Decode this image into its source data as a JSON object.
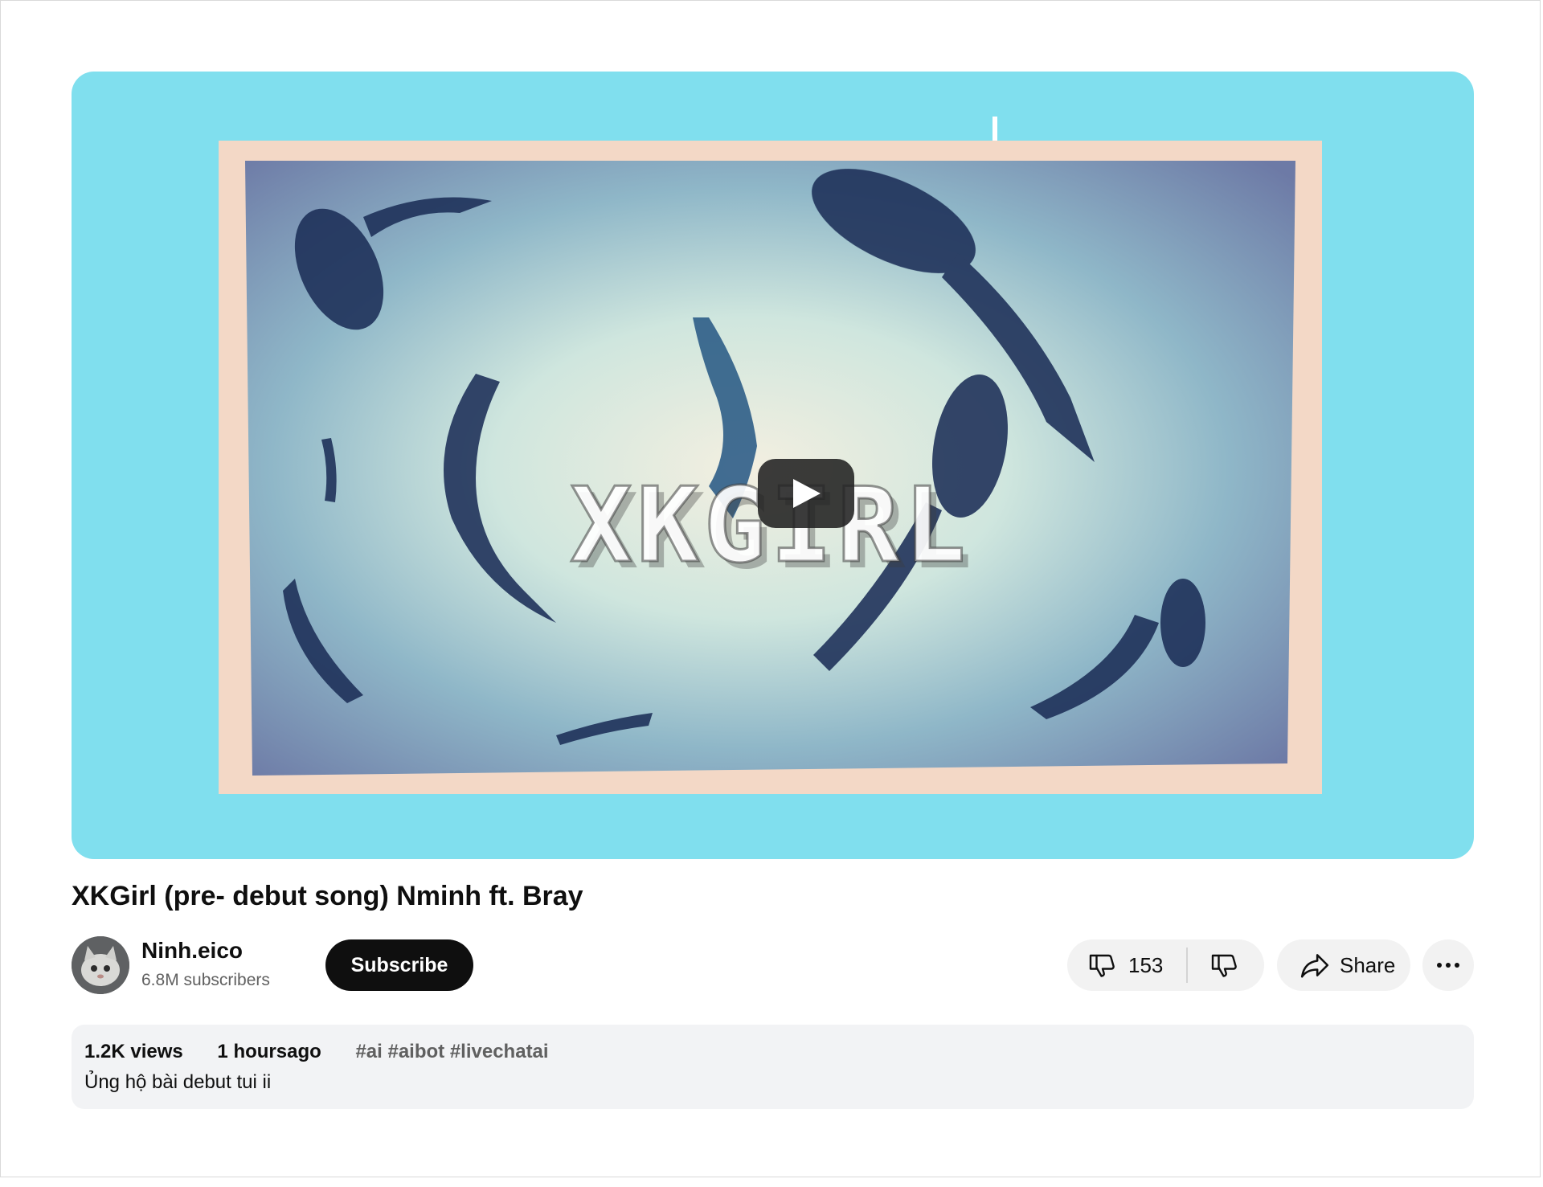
{
  "player": {
    "overlay_text": "XKGIRL",
    "play_icon": "play-icon",
    "colors": {
      "background": "#80dfee",
      "thumbnail_paper": "#f3d8c6"
    }
  },
  "video": {
    "title": "XKGirl (pre- debut song) Nminh ft. Bray"
  },
  "channel": {
    "name": "Ninh.eico",
    "subscribers": "6.8M subscribers",
    "subscribe_label": "Subscribe"
  },
  "actions": {
    "like_count": "153",
    "like_icon": "thumbs-down-icon",
    "dislike_icon": "thumbs-down-icon",
    "share_label": "Share",
    "share_icon": "share-icon",
    "more_icon": "more-horizontal-icon"
  },
  "description": {
    "views": "1.2K views",
    "time_ago": "1 hoursago",
    "hashtags": "#ai #aibot #livechatai",
    "text": "Ủng hộ bài debut tui ii"
  }
}
